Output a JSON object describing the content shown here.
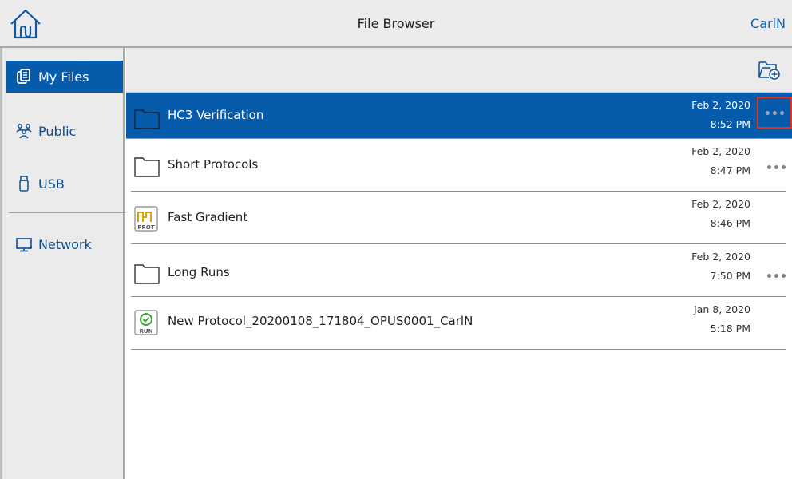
{
  "header": {
    "title": "File Browser",
    "user": "CarlN"
  },
  "sidebar": {
    "items": [
      {
        "label": "My Files",
        "icon": "files-icon",
        "active": true
      },
      {
        "label": "Public",
        "icon": "people-icon",
        "active": false
      },
      {
        "label": "USB",
        "icon": "usb-icon",
        "active": false
      },
      {
        "label": "Network",
        "icon": "monitor-icon",
        "active": false
      }
    ]
  },
  "toolbar": {
    "new_folder_icon": "new-folder-icon"
  },
  "files": [
    {
      "name": "HC3 Verification",
      "type": "folder",
      "date": "Feb 2, 2020",
      "time": "8:52 PM",
      "selected": true,
      "has_menu": true
    },
    {
      "name": "Short Protocols",
      "type": "folder",
      "date": "Feb 2, 2020",
      "time": "8:47 PM",
      "selected": false,
      "has_menu": true
    },
    {
      "name": "Fast Gradient",
      "type": "protocol",
      "badge": "PROT",
      "date": "Feb 2, 2020",
      "time": "8:46 PM",
      "selected": false,
      "has_menu": false
    },
    {
      "name": "Long Runs",
      "type": "folder",
      "date": "Feb 2, 2020",
      "time": "7:50 PM",
      "selected": false,
      "has_menu": true
    },
    {
      "name": "New Protocol_20200108_171804_OPUS0001_CarlN",
      "type": "run",
      "badge": "RUN",
      "date": "Jan 8, 2020",
      "time": "5:18 PM",
      "selected": false,
      "has_menu": false
    }
  ],
  "colors": {
    "accent": "#075bab",
    "link": "#1160b0",
    "highlight_border": "#e0302a",
    "protocol_icon": "#e0a100",
    "run_icon": "#3aa335"
  }
}
